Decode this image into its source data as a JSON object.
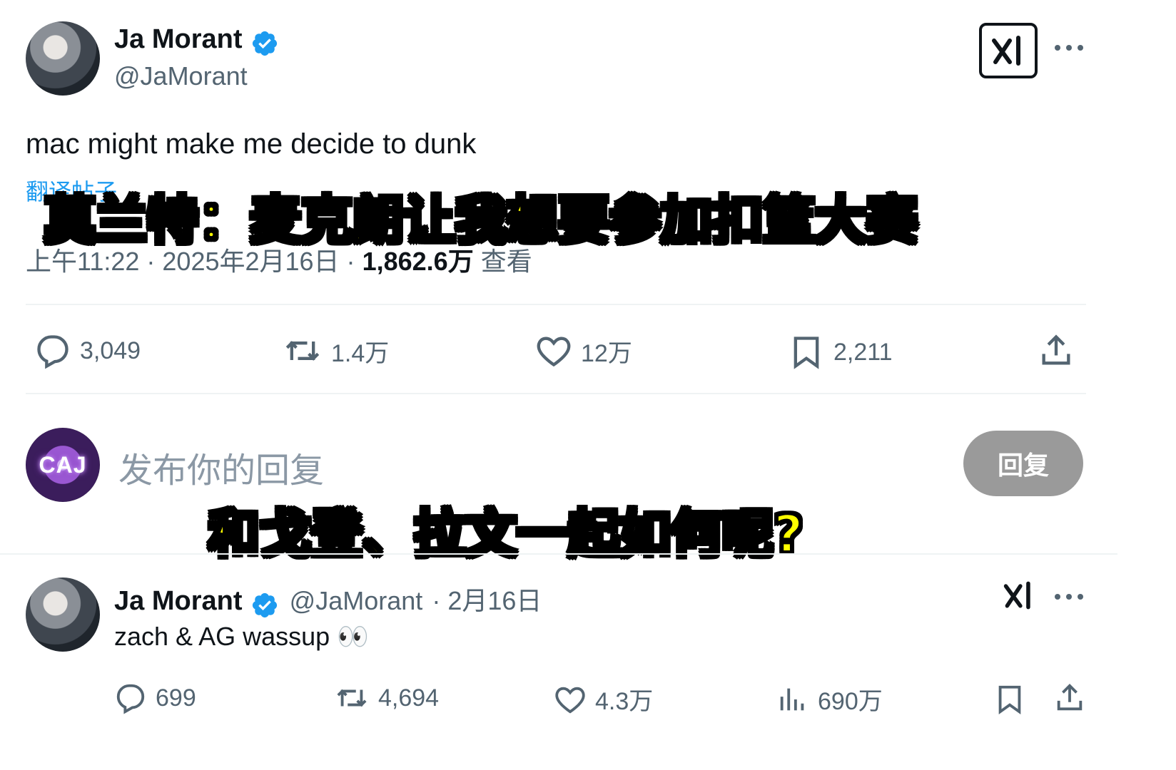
{
  "tweet": {
    "author_name": "Ja Morant",
    "author_handle": "@JaMorant",
    "text": "mac might make me decide to dunk",
    "translate_link": "翻译帖子",
    "timestamp": "上午11:22 · 2025年2月16日 ·",
    "views_count": "1,862.6万",
    "views_label": "查看",
    "stats": {
      "replies": "3,049",
      "reposts": "1.4万",
      "likes": "12万",
      "bookmarks": "2,211"
    }
  },
  "reply_composer": {
    "placeholder": "发布你的回复",
    "button_label": "回复",
    "avatar_text": "CAJ"
  },
  "captions": {
    "top": "莫兰特：麦克朗让我想要参加扣篮大赛",
    "bottom": "和戈登、拉文一起如何呢?"
  },
  "reply_tweet": {
    "author_name": "Ja Morant",
    "author_handle": "@JaMorant",
    "date": "· 2月16日",
    "text": "zach & AG wassup 👀",
    "stats": {
      "replies": "699",
      "reposts": "4,694",
      "likes": "4.3万",
      "views": "690万"
    }
  },
  "colors": {
    "verified": "#1d9bf0",
    "caption_fill": "#ffff00",
    "caption_stroke": "#000000",
    "muted": "#536471",
    "reply_button": "#9a9a9a"
  },
  "icons": [
    "verified-badge-icon",
    "grok-icon",
    "more-icon",
    "reply-icon",
    "repost-icon",
    "like-icon",
    "bookmark-icon",
    "share-icon",
    "views-icon"
  ]
}
